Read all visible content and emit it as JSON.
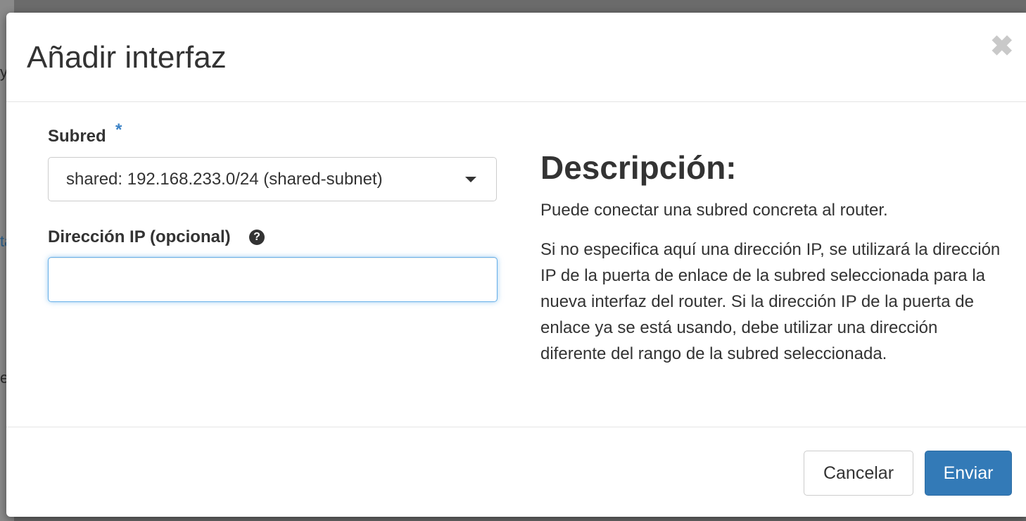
{
  "dialog": {
    "title": "Añadir interfaz",
    "close_symbol": "✖"
  },
  "form": {
    "subnet_label": "Subred",
    "required_marker": "*",
    "subnet_selected": "shared: 192.168.233.0/24 (shared-subnet)",
    "ip_label": "Dirección IP (opcional)",
    "help_symbol": "?",
    "ip_value": ""
  },
  "description": {
    "title": "Descripción:",
    "paragraph1": "Puede conectar una subred concreta al router.",
    "paragraph2": "Si no especifica aquí una dirección IP, se utilizará la dirección IP de la puerta de enlace de la subred seleccionada para la nueva interfaz del router. Si la dirección IP de la puerta de enlace ya se está usando, debe utilizar una dirección diferente del rango de la subred seleccionada."
  },
  "footer": {
    "cancel_label": "Cancelar",
    "submit_label": "Enviar"
  },
  "background": {
    "fragments": [
      "y",
      "ta",
      "e"
    ]
  },
  "colors": {
    "primary": "#337ab7",
    "required": "#3a82c6",
    "focus_border": "#66afe9"
  },
  "icons": {
    "close": "close-icon",
    "help": "question-circle-icon",
    "dropdown": "caret-down-icon"
  }
}
